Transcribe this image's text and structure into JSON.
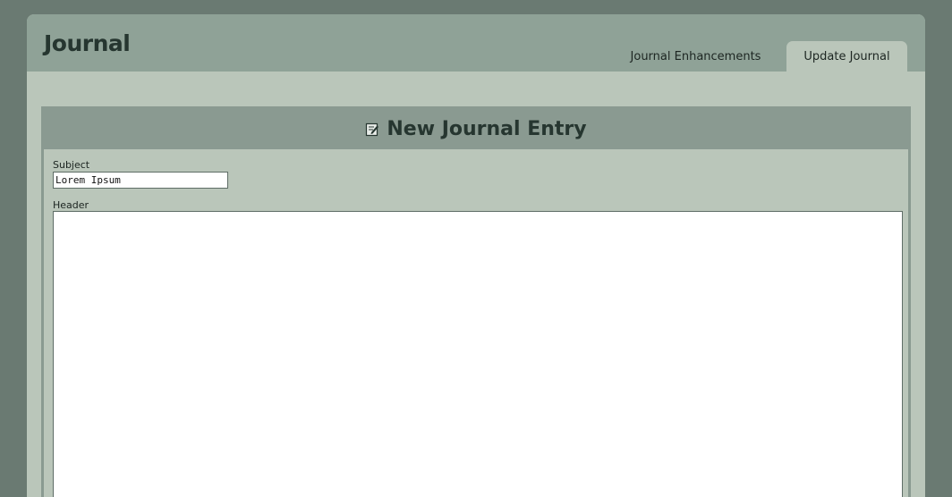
{
  "app": {
    "title": "Journal"
  },
  "tabs": [
    {
      "label": "Journal Enhancements",
      "active": false
    },
    {
      "label": "Update Journal",
      "active": true
    }
  ],
  "panel": {
    "title": "New Journal Entry",
    "icon": "edit-icon"
  },
  "form": {
    "subject_label": "Subject",
    "subject_value": "Lorem Ipsum",
    "header_label": "Header",
    "header_value": ""
  },
  "colors": {
    "background": "#6a7a72",
    "titlebar": "#8fa297",
    "content": "#bac6ba",
    "panel_header": "#8a9a91",
    "text_dark": "#263630"
  }
}
